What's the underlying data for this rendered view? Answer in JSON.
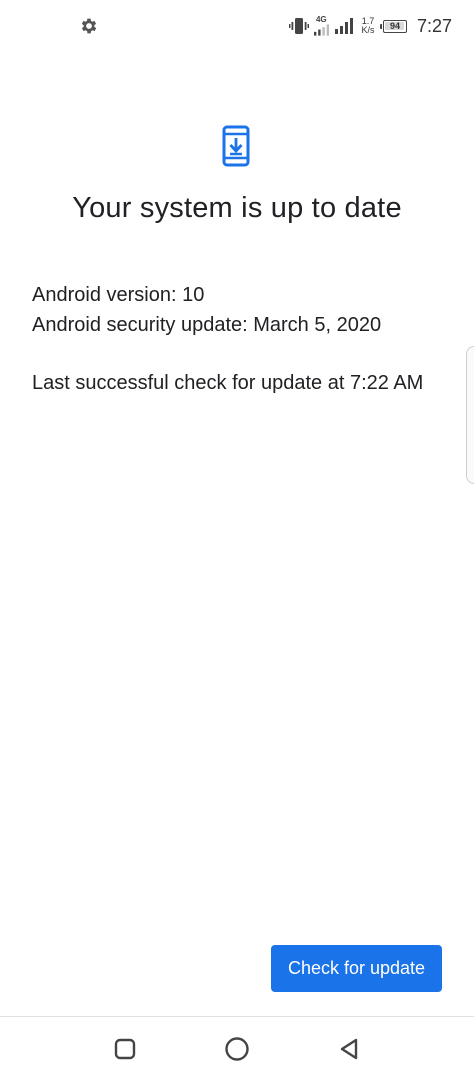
{
  "status_bar": {
    "network_type": "4G",
    "speed_value": "1.7",
    "speed_unit": "K/s",
    "battery_level": "94",
    "time": "7:27",
    "icons": [
      "gear-icon",
      "vibrate-icon",
      "signal-icon",
      "battery-icon"
    ]
  },
  "main": {
    "title": "Your system is up to date",
    "android_version": "Android version: 10",
    "security_update": "Android security update: March 5, 2020",
    "last_check": "Last successful check for update at 7:22 AM"
  },
  "actions": {
    "check_update_label": "Check for update"
  },
  "nav_bar": {
    "buttons": [
      "recents-icon",
      "home-icon",
      "back-icon"
    ]
  },
  "colors": {
    "accent": "#1a73e8",
    "text": "#202124",
    "background": "#ffffff"
  }
}
